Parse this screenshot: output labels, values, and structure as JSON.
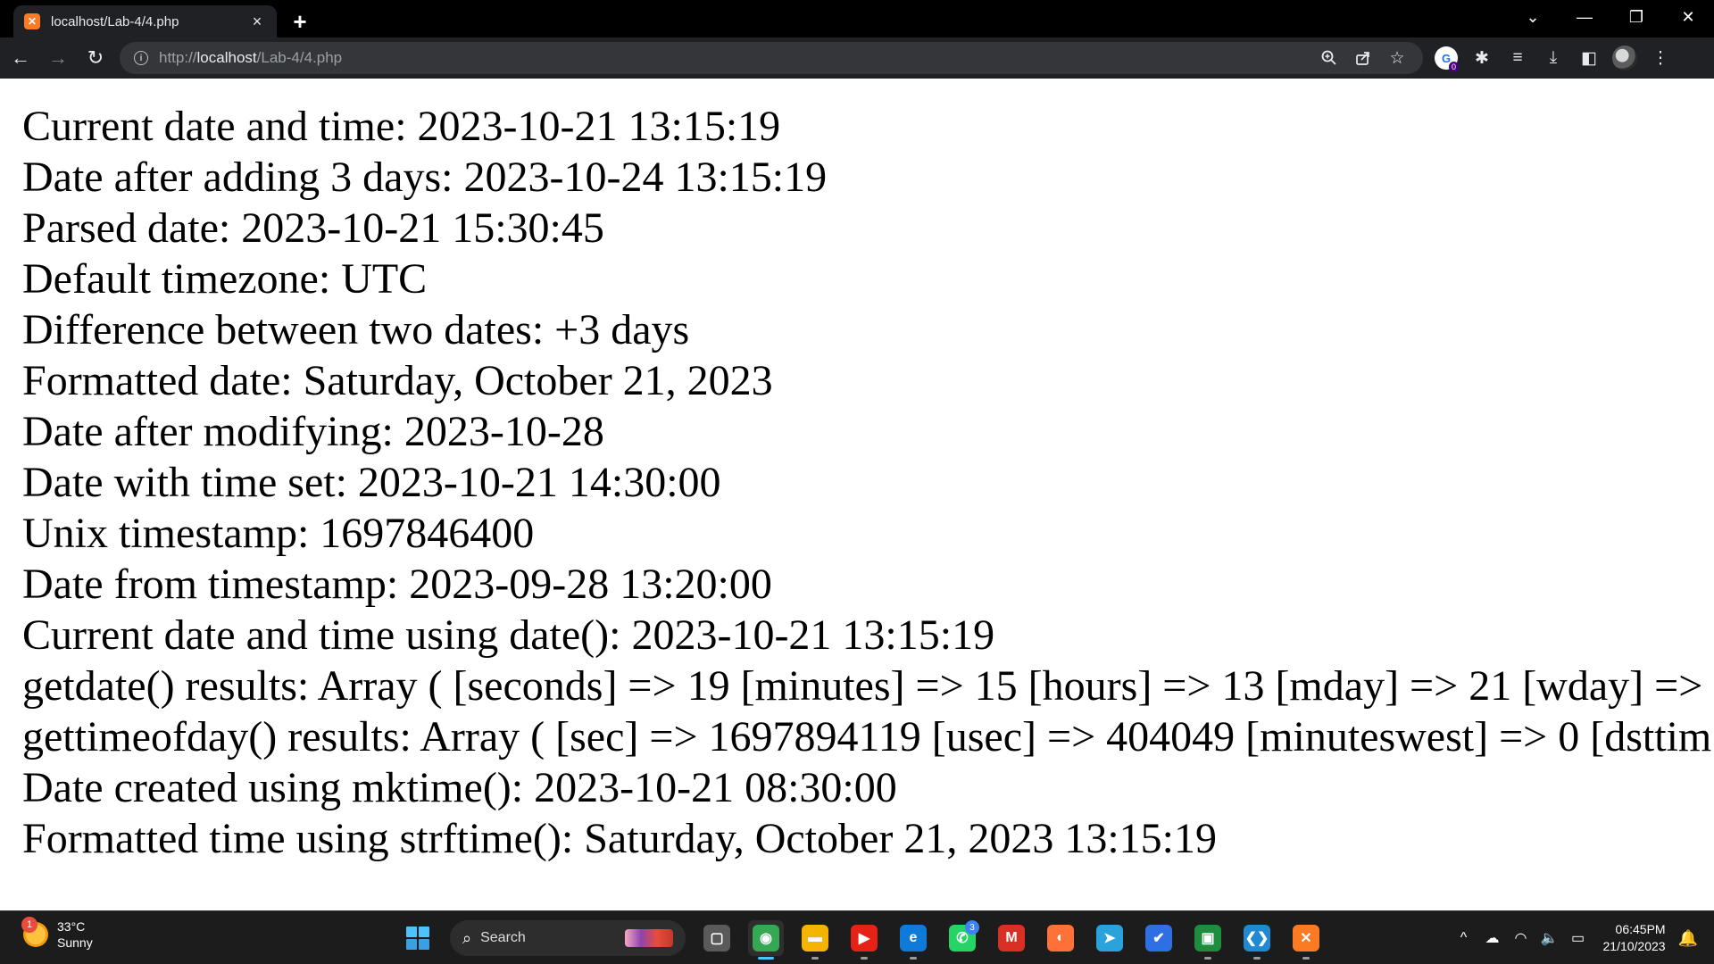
{
  "browser": {
    "tab": {
      "title": "localhost/Lab-4/4.php",
      "favicon": "xampp-icon",
      "close_label": "×"
    },
    "new_tab_label": "+",
    "window_controls": {
      "chevron": "⌄",
      "minimize": "—",
      "restore": "❐",
      "close": "✕"
    },
    "nav": {
      "back": "←",
      "forward": "→",
      "reload": "↻"
    },
    "address": {
      "scheme": "http://",
      "host": "localhost",
      "path": "/Lab-4/4.php"
    },
    "omnibox_icons": [
      "zoom-icon",
      "share-icon",
      "bookmark-star-icon"
    ],
    "extensions": {
      "profile_ext_letter": "G",
      "profile_ext_badge": "0"
    }
  },
  "page": {
    "lines": [
      "Current date and time: 2023-10-21 13:15:19",
      "Date after adding 3 days: 2023-10-24 13:15:19",
      "Parsed date: 2023-10-21 15:30:45",
      "Default timezone: UTC",
      "Difference between two dates: +3 days",
      "Formatted date: Saturday, October 21, 2023",
      "Date after modifying: 2023-10-28",
      "Date with time set: 2023-10-21 14:30:00",
      "Unix timestamp: 1697846400",
      "Date from timestamp: 2023-09-28 13:20:00",
      "Current date and time using date(): 2023-10-21 13:15:19",
      "getdate() results: Array ( [seconds] => 19 [minutes] => 15 [hours] => 13 [mday] => 21 [wday] =>",
      "gettimeofday() results: Array ( [sec] => 1697894119 [usec] => 404049 [minuteswest] => 0 [dsttim",
      "Date created using mktime(): 2023-10-21 08:30:00",
      "Formatted time using strftime(): Saturday, October 21, 2023 13:15:19"
    ]
  },
  "taskbar": {
    "weather": {
      "badge": "1",
      "temp": "33°C",
      "condition": "Sunny"
    },
    "search_label": "Search",
    "apps": [
      {
        "name": "task-view-icon",
        "glyph": "▢",
        "color": "#5a5a5a",
        "state": "none"
      },
      {
        "name": "chrome-icon",
        "glyph": "◉",
        "color": "#34a853",
        "state": "active"
      },
      {
        "name": "file-explorer-icon",
        "glyph": "▬",
        "color": "#f4b400",
        "state": "running"
      },
      {
        "name": "youtube-icon",
        "glyph": "▶",
        "color": "#e62117",
        "state": "running"
      },
      {
        "name": "edge-icon",
        "glyph": "e",
        "color": "#0f7ad8",
        "state": "running"
      },
      {
        "name": "whatsapp-icon",
        "glyph": "✆",
        "color": "#25d366",
        "state": "none",
        "badge": "3"
      },
      {
        "name": "gmail-icon",
        "glyph": "M",
        "color": "#d93025",
        "state": "none"
      },
      {
        "name": "firefox-icon",
        "glyph": "◐",
        "color": "#ff7139",
        "state": "none"
      },
      {
        "name": "telegram-icon",
        "glyph": "➤",
        "color": "#2aa3dd",
        "state": "none"
      },
      {
        "name": "todo-icon",
        "glyph": "✔",
        "color": "#2f6fe4",
        "state": "none"
      },
      {
        "name": "classroom-icon",
        "glyph": "▣",
        "color": "#1e8e3e",
        "state": "running"
      },
      {
        "name": "vscode-icon",
        "glyph": "❮❯",
        "color": "#1f8ad2",
        "state": "running"
      },
      {
        "name": "xampp-icon",
        "glyph": "✕",
        "color": "#fb7a24",
        "state": "running"
      }
    ],
    "tray": {
      "chevron": "^",
      "onedrive": "☁",
      "wifi": "◠",
      "volume": "🔈",
      "battery": "▭"
    },
    "clock": {
      "time": "06:45PM",
      "date": "21/10/2023"
    },
    "notification": "🔔"
  }
}
